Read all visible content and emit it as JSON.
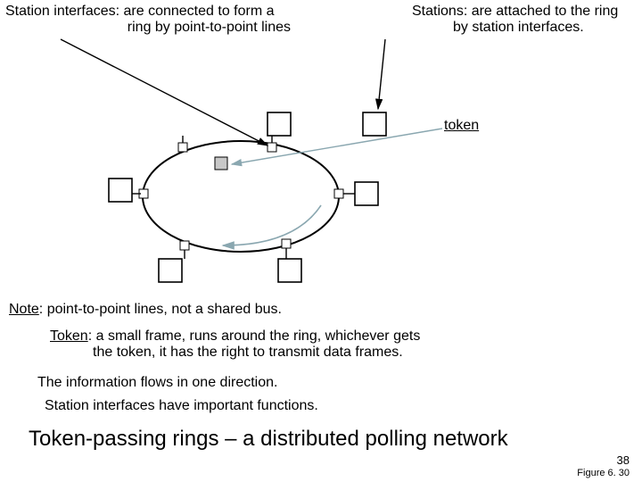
{
  "labels": {
    "station_interfaces_l1": "Station interfaces: are connected to form  a",
    "station_interfaces_l2": "ring by point-to-point lines",
    "stations_l1": "Stations: are attached to the ring",
    "stations_l2": "by station interfaces.",
    "token": "token"
  },
  "notes": {
    "ptp_prefix": "Note",
    "ptp_rest": ": point-to-point lines, not a shared bus.",
    "token_prefix": "Token",
    "token_rest": ": a small frame, runs around the ring, whichever gets",
    "token_l2": "the token, it has the right to transmit data frames.",
    "info_flow": "The information flows in one direction.",
    "si_functions": "Station interfaces have important functions."
  },
  "title": "Token-passing rings – a distributed polling network",
  "footer": {
    "page": "38",
    "figure": "Figure 6. 30"
  }
}
